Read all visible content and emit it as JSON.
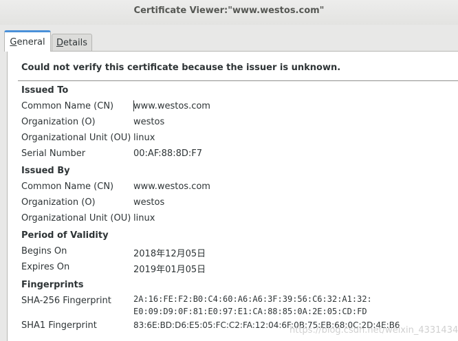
{
  "window": {
    "title": "Certificate Viewer:\"www.westos.com\""
  },
  "tabs": [
    {
      "label": "General",
      "underline": "G",
      "rest": "eneral",
      "active": true
    },
    {
      "label": "Details",
      "underline": "D",
      "rest": "etails",
      "active": false
    }
  ],
  "general": {
    "warning": "Could not verify this certificate because the issuer is unknown.",
    "issued_to": {
      "heading": "Issued To",
      "rows": [
        {
          "label": "Common Name (CN)",
          "value": "www.westos.com"
        },
        {
          "label": "Organization (O)",
          "value": "westos"
        },
        {
          "label": "Organizational Unit (OU)",
          "value": "linux"
        },
        {
          "label": "Serial Number",
          "value": "00:AF:88:8D:F7"
        }
      ]
    },
    "issued_by": {
      "heading": "Issued By",
      "rows": [
        {
          "label": "Common Name (CN)",
          "value": "www.westos.com"
        },
        {
          "label": "Organization (O)",
          "value": "westos"
        },
        {
          "label": "Organizational Unit (OU)",
          "value": "linux"
        }
      ]
    },
    "validity": {
      "heading": "Period of Validity",
      "rows": [
        {
          "label": "Begins On",
          "value": "2018年12月05日"
        },
        {
          "label": "Expires On",
          "value": "2019年01月05日"
        }
      ]
    },
    "fingerprints": {
      "heading": "Fingerprints",
      "rows": [
        {
          "label": "SHA-256 Fingerprint",
          "value": "2A:16:FE:F2:B0:C4:60:A6:A6:3F:39:56:C6:32:A1:32:\nE0:09:D9:0F:81:E0:97:E1:CA:88:85:0A:2E:05:CD:FD"
        },
        {
          "label": "SHA1 Fingerprint",
          "value": "83:6E:BD:D6:E5:05:FC:C2:FA:12:04:6F:0B:75:EB:68:0C:2D:4E:B6"
        }
      ]
    }
  },
  "watermark": "https://blog.csdn.net/weixin_43314345",
  "colors": {
    "tab_accent": "#4a90d9",
    "text": "#2e3436",
    "title": "#555753"
  }
}
